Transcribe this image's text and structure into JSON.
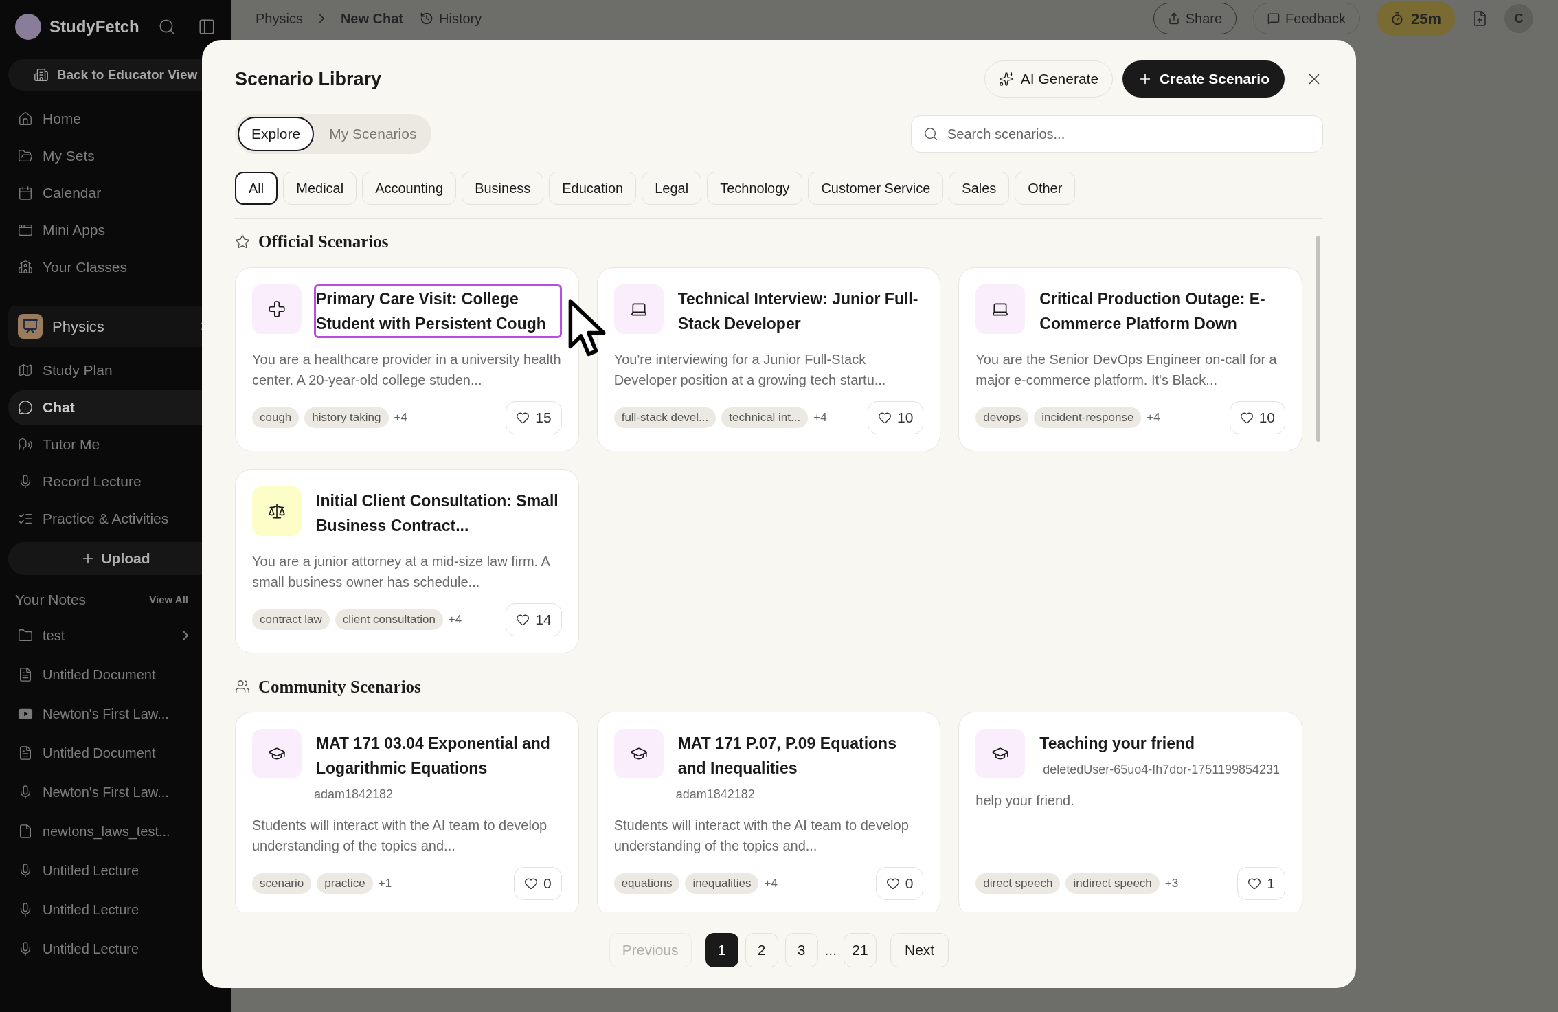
{
  "sidebar": {
    "brand": "StudyFetch",
    "back_button": "Back to Educator View",
    "nav": [
      {
        "label": "Home",
        "kind": "home"
      },
      {
        "label": "My Sets",
        "kind": "folder"
      },
      {
        "label": "Calendar",
        "kind": "calendar"
      },
      {
        "label": "Mini Apps",
        "kind": "app"
      },
      {
        "label": "Your Classes",
        "kind": "school"
      }
    ],
    "course": "Physics",
    "course_nav": [
      {
        "label": "Study Plan",
        "kind": "map",
        "selected": false
      },
      {
        "label": "Chat",
        "kind": "chat",
        "selected": true
      },
      {
        "label": "Tutor Me",
        "kind": "speech",
        "selected": false
      },
      {
        "label": "Record Lecture",
        "kind": "mic",
        "selected": false
      },
      {
        "label": "Practice & Activities",
        "kind": "list",
        "selected": false
      }
    ],
    "upload": "Upload",
    "notes_title": "Your Notes",
    "view_all": "View All",
    "notes": [
      {
        "label": "test",
        "kind": "folder-plain"
      },
      {
        "label": "Untitled Document",
        "kind": "doc"
      },
      {
        "label": "Newton's First Law...",
        "kind": "video"
      },
      {
        "label": "Untitled Document",
        "kind": "doc"
      },
      {
        "label": "Newton's First Law...",
        "kind": "mic"
      },
      {
        "label": "newtons_laws_test...",
        "kind": "pdf"
      },
      {
        "label": "Untitled Lecture",
        "kind": "mic"
      },
      {
        "label": "Untitled Lecture",
        "kind": "mic"
      },
      {
        "label": "Untitled Lecture",
        "kind": "mic"
      }
    ]
  },
  "topbar": {
    "breadcrumb": [
      "Physics",
      "New Chat"
    ],
    "history": "History",
    "share": "Share",
    "feedback": "Feedback",
    "timer": "25m",
    "avatar": "C"
  },
  "modal": {
    "title": "Scenario Library",
    "ai_generate": "AI Generate",
    "create": "Create Scenario",
    "tabs": [
      {
        "label": "Explore",
        "selected": true
      },
      {
        "label": "My Scenarios",
        "selected": false
      }
    ],
    "search": {
      "placeholder": "Search scenarios..."
    },
    "categories": [
      {
        "label": "All",
        "selected": true
      },
      {
        "label": "Medical",
        "selected": false
      },
      {
        "label": "Accounting",
        "selected": false
      },
      {
        "label": "Business",
        "selected": false
      },
      {
        "label": "Education",
        "selected": false
      },
      {
        "label": "Legal",
        "selected": false
      },
      {
        "label": "Technology",
        "selected": false
      },
      {
        "label": "Customer Service",
        "selected": false
      },
      {
        "label": "Sales",
        "selected": false
      },
      {
        "label": "Other",
        "selected": false
      }
    ],
    "sections": [
      {
        "title": "Official Scenarios",
        "kind": "star",
        "cards": [
          {
            "kind": "cross",
            "color": "#fbeefc",
            "title": "Primary Care Visit: College Student with Persistent Cough",
            "focused": true,
            "description": "You are a healthcare provider in a university health center. A 20-year-old college studen...",
            "tags": [
              "cough",
              "history taking"
            ],
            "more": "+4",
            "likes": "15"
          },
          {
            "kind": "laptop",
            "color": "#fbeefc",
            "title": "Technical Interview: Junior Full-Stack Developer",
            "focused": false,
            "description": "You're interviewing for a Junior Full-Stack Developer position at a growing tech startu...",
            "tags": [
              "full-stack devel...",
              "technical int..."
            ],
            "more": "+4",
            "likes": "10"
          },
          {
            "kind": "laptop",
            "color": "#fbeefc",
            "title": "Critical Production Outage: E-Commerce Platform Down",
            "focused": false,
            "description": "You are the Senior DevOps Engineer on-call for a major e-commerce platform. It's Black...",
            "tags": [
              "devops",
              "incident-response"
            ],
            "more": "+4",
            "likes": "10"
          },
          {
            "kind": "scale",
            "color": "#fdfdc8",
            "title": "Initial Client Consultation: Small Business Contract...",
            "focused": false,
            "description": "You are a junior attorney at a mid-size law firm. A small business owner has schedule...",
            "tags": [
              "contract law",
              "client consultation"
            ],
            "more": "+4",
            "likes": "14"
          }
        ]
      },
      {
        "title": "Community Scenarios",
        "kind": "users",
        "cards": [
          {
            "kind": "cap",
            "color": "#fbeefc",
            "title": "MAT 171 03.04 Exponential and Logarithmic Equations",
            "author": "adam1842182",
            "focused": false,
            "description": "Students will interact with the AI team to develop understanding of the topics and...",
            "tags": [
              "scenario",
              "practice"
            ],
            "more": "+1",
            "likes": "0"
          },
          {
            "kind": "cap",
            "color": "#fbeefc",
            "title": "MAT 171 P.07, P.09 Equations and Inequalities",
            "author": "adam1842182",
            "focused": false,
            "description": "Students will interact with the AI team to develop understanding of the topics and...",
            "tags": [
              "equations",
              "inequalities"
            ],
            "more": "+4",
            "likes": "0"
          },
          {
            "kind": "cap",
            "color": "#fbeefc",
            "title": "Teaching your friend",
            "author": "deletedUser-65uo4-fh7dor-1751199854231",
            "focused": false,
            "description": "help your friend.",
            "tags": [
              "direct speech",
              "indirect speech"
            ],
            "more": "+3",
            "likes": "1"
          }
        ]
      }
    ],
    "pagination": {
      "previous": "Previous",
      "previous_disabled": true,
      "pages": [
        {
          "label": "1",
          "selected": true
        },
        {
          "label": "2",
          "selected": false
        },
        {
          "label": "3",
          "selected": false
        }
      ],
      "ellipsis": "...",
      "last": {
        "label": "21",
        "selected": false
      },
      "next": "Next"
    }
  }
}
